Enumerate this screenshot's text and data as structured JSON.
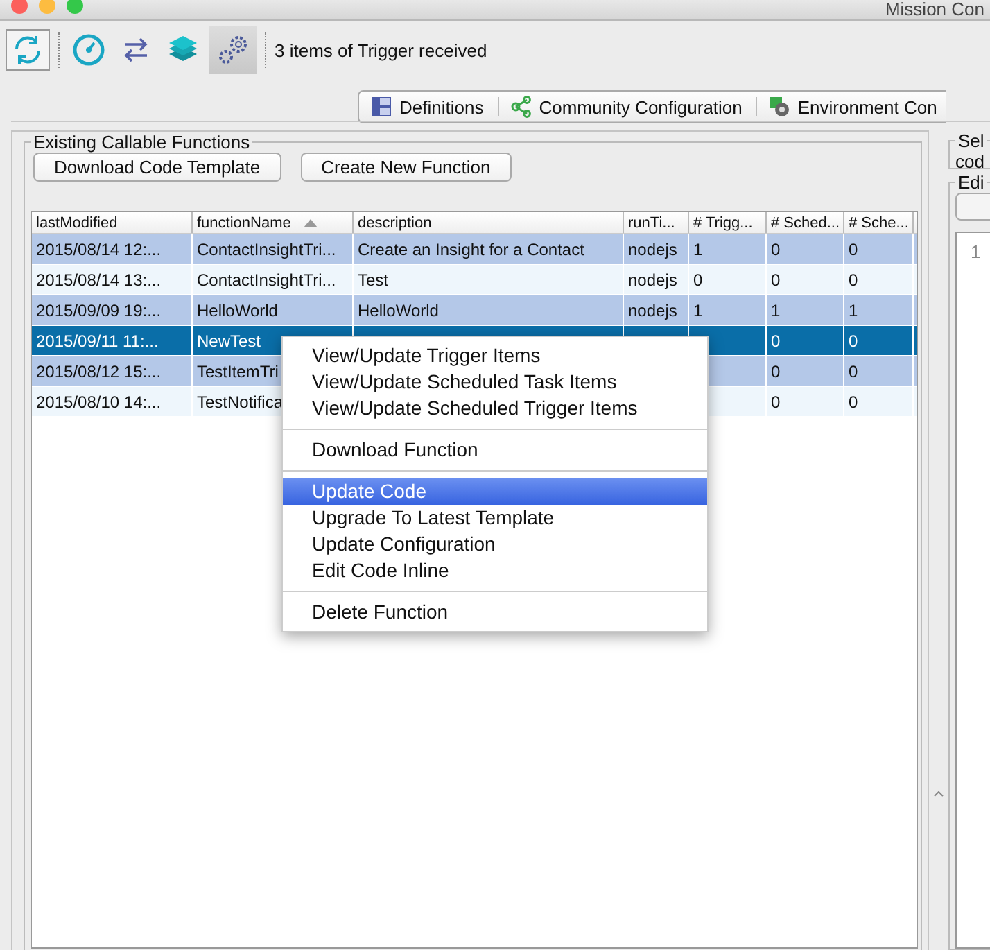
{
  "window": {
    "title": "Mission Con"
  },
  "toolbar": {
    "status": "3 items of Trigger received"
  },
  "tabs": [
    {
      "label": "Definitions",
      "selected": false
    },
    {
      "label": "Community Configuration",
      "selected": false
    },
    {
      "label": "Environment Con",
      "selected": false
    }
  ],
  "functions_panel": {
    "title": "Existing Callable Functions",
    "buttons": [
      "Download Code Template",
      "Create New Function"
    ],
    "table": {
      "columns": [
        {
          "label": "lastModified",
          "sorted": false
        },
        {
          "label": "functionName",
          "sorted": true
        },
        {
          "label": "description",
          "sorted": false
        },
        {
          "label": "runTi...",
          "sorted": false
        },
        {
          "label": "# Trigg...",
          "sorted": false
        },
        {
          "label": "# Sched...",
          "sorted": false
        },
        {
          "label": "# Sche...",
          "sorted": false
        }
      ],
      "rows": [
        {
          "selected": false,
          "cells": [
            "2015/08/14 12:...",
            "ContactInsightTri...",
            "Create an Insight for a Contact",
            "nodejs",
            "1",
            "0",
            "0"
          ]
        },
        {
          "selected": false,
          "cells": [
            "2015/08/14 13:...",
            "ContactInsightTri...",
            "Test",
            "nodejs",
            "0",
            "0",
            "0"
          ]
        },
        {
          "selected": false,
          "cells": [
            "2015/09/09 19:...",
            "HelloWorld",
            "HelloWorld",
            "nodejs",
            "1",
            "1",
            "1"
          ]
        },
        {
          "selected": true,
          "cells": [
            "2015/09/11 11:...",
            "NewTest",
            null,
            null,
            null,
            "0",
            "0"
          ]
        },
        {
          "selected": false,
          "cells": [
            "2015/08/12 15:...",
            "TestItemTri",
            null,
            null,
            null,
            "0",
            "0"
          ]
        },
        {
          "selected": false,
          "cells": [
            "2015/08/10 14:...",
            "TestNotifica",
            null,
            null,
            null,
            "0",
            "0"
          ]
        }
      ]
    }
  },
  "context_menu": {
    "groups": [
      [
        {
          "label": "View/Update Trigger Items",
          "selected": false
        },
        {
          "label": "View/Update Scheduled Task Items",
          "selected": false
        },
        {
          "label": "View/Update Scheduled Trigger Items",
          "selected": false
        }
      ],
      [
        {
          "label": "Download Function",
          "selected": false
        }
      ],
      [
        {
          "label": "Update Code",
          "selected": true
        },
        {
          "label": "Upgrade To Latest Template",
          "selected": false
        },
        {
          "label": "Update Configuration",
          "selected": false
        },
        {
          "label": "Edit Code Inline",
          "selected": false
        }
      ],
      [
        {
          "label": "Delete Function",
          "selected": false
        }
      ]
    ]
  },
  "right_panel": {
    "select_title": "Sel",
    "select_text": "cod",
    "editor_title": "Edi",
    "line_number": "1"
  }
}
